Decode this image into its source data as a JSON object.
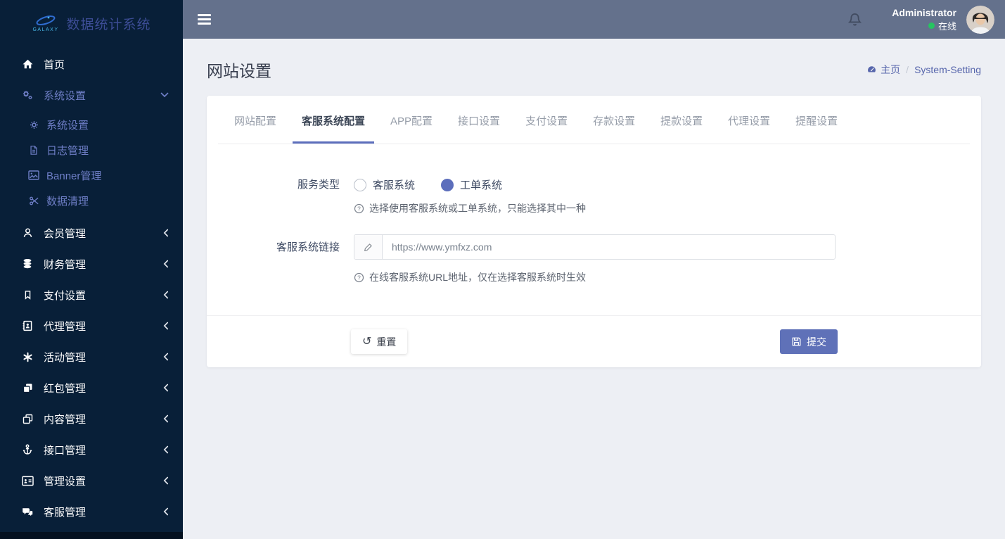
{
  "brand": {
    "logo_text": "GALAXY",
    "app_title": "数据统计系统"
  },
  "topbar": {
    "username": "Administrator",
    "status_label": "在线"
  },
  "sidebar": {
    "items": [
      "首页",
      "系统设置",
      "会员管理",
      "财务管理",
      "支付设置",
      "代理管理",
      "活动管理",
      "红包管理",
      "内容管理",
      "接口管理",
      "管理设置",
      "客服管理"
    ],
    "subitems": [
      "系统设置",
      "日志管理",
      "Banner管理",
      "数据清理"
    ]
  },
  "page": {
    "title": "网站设置",
    "breadcrumb": {
      "home": "主页",
      "separator": "/",
      "current": "System-Setting"
    }
  },
  "tabs": [
    "网站配置",
    "客服系统配置",
    "APP配置",
    "接口设置",
    "支付设置",
    "存款设置",
    "提款设置",
    "代理设置",
    "提醒设置"
  ],
  "form": {
    "service_type": {
      "label": "服务类型",
      "option_customer": "客服系统",
      "option_ticket": "工单系统",
      "selected": "工单系统",
      "help": "选择使用客服系统或工单系统，只能选择其中一种"
    },
    "service_link": {
      "label": "客服系统链接",
      "value": "https://www.ymfxz.com",
      "help": "在线客服系统URL地址，仅在选择客服系统时生效"
    }
  },
  "footer": {
    "reset_label": "重置",
    "submit_label": "提交"
  },
  "icons": {
    "undo_glyph": "↺"
  },
  "colors": {
    "accent": "#5c6ebc",
    "sidebar_bg": "#081f38",
    "header_bg": "#64718c",
    "online": "#26c461"
  }
}
